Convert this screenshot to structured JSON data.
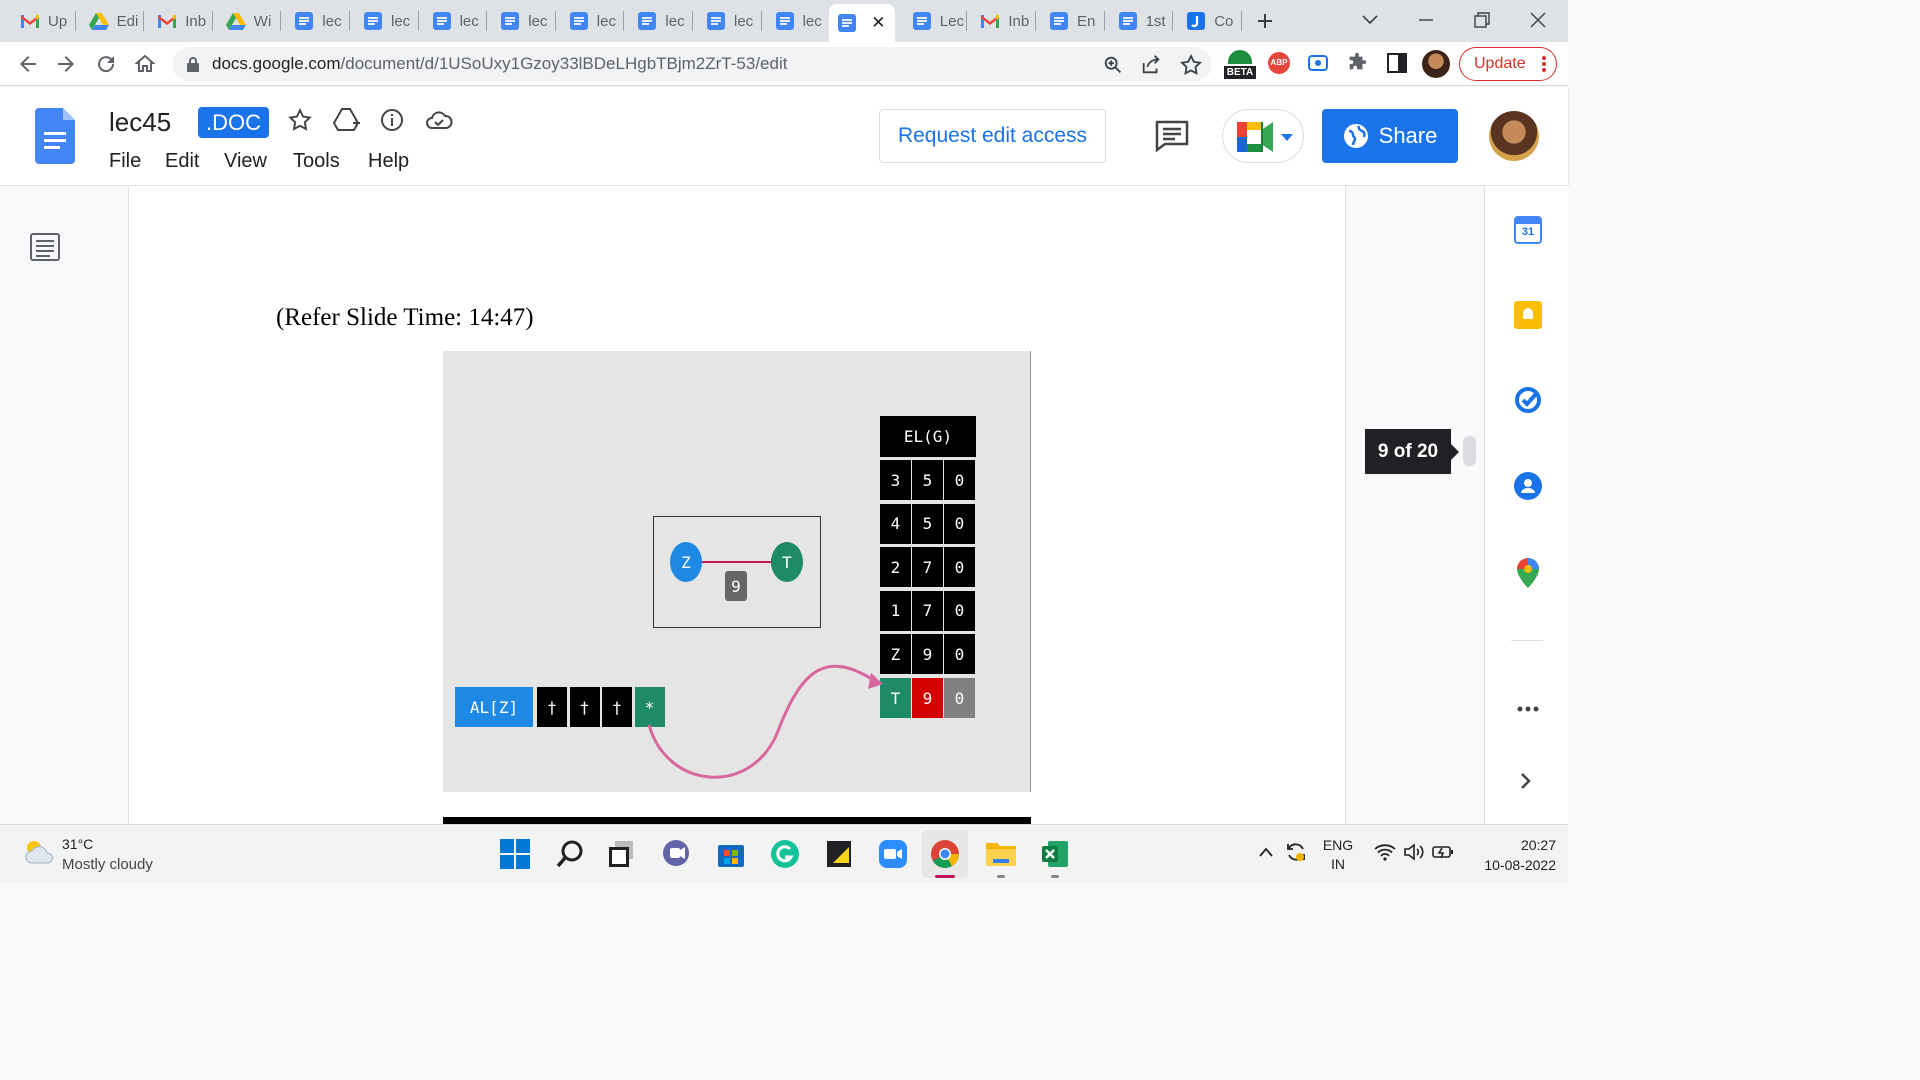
{
  "browser": {
    "tabs": [
      {
        "label": "Up",
        "icon": "gmail-icon"
      },
      {
        "label": "Edi",
        "icon": "drive-icon"
      },
      {
        "label": "Inb",
        "icon": "gmail-icon"
      },
      {
        "label": "Wi",
        "icon": "drive-icon"
      },
      {
        "label": "lec",
        "icon": "docs-icon"
      },
      {
        "label": "lec",
        "icon": "docs-icon"
      },
      {
        "label": "lec",
        "icon": "docs-icon"
      },
      {
        "label": "lec",
        "icon": "docs-icon"
      },
      {
        "label": "lec",
        "icon": "docs-icon"
      },
      {
        "label": "lec",
        "icon": "docs-icon"
      },
      {
        "label": "lec",
        "icon": "docs-icon"
      },
      {
        "label": "lec",
        "icon": "docs-icon"
      },
      {
        "label": "",
        "icon": "docs-icon",
        "active": true
      },
      {
        "label": "Lec",
        "icon": "docs-icon"
      },
      {
        "label": "Inb",
        "icon": "gmail-icon"
      },
      {
        "label": "En",
        "icon": "docs-icon"
      },
      {
        "label": "1st",
        "icon": "docs-icon"
      },
      {
        "label": "Co",
        "icon": "jamboard-icon"
      }
    ],
    "url_host": "docs.google.com",
    "url_path": "/document/d/1USoUxy1Gzoy33lBDeLHgbTBjm2ZrT-53/edit",
    "update_label": "Update",
    "beta_label": "BETA",
    "abp_label": "ABP"
  },
  "docs": {
    "title": "lec45",
    "badge": ".DOC",
    "menu": [
      "File",
      "Edit",
      "View",
      "Tools",
      "Help"
    ],
    "request_edit_label": "Request edit access",
    "share_label": "Share"
  },
  "document": {
    "caption": "(Refer Slide Time: 14:47)",
    "page_indicator": "9 of 20"
  },
  "slide": {
    "graph": {
      "node_from": "Z",
      "node_to": "T",
      "edge_weight": "9"
    },
    "edge_list": {
      "title": "EL(G)",
      "rows": [
        [
          "3",
          "5",
          "0"
        ],
        [
          "4",
          "5",
          "0"
        ],
        [
          "2",
          "7",
          "0"
        ],
        [
          "1",
          "7",
          "0"
        ],
        [
          "Z",
          "9",
          "0"
        ],
        [
          "T",
          "9",
          "0"
        ]
      ]
    },
    "adjacency": {
      "label": "AL[Z]",
      "cells": [
        "†",
        "†",
        "†",
        "*"
      ]
    }
  },
  "taskbar": {
    "weather_temp": "31°C",
    "weather_desc": "Mostly cloudy",
    "lang_top": "ENG",
    "lang_bottom": "IN",
    "time": "20:27",
    "date": "10-08-2022"
  },
  "side_panel": {
    "calendar_day": "31"
  }
}
